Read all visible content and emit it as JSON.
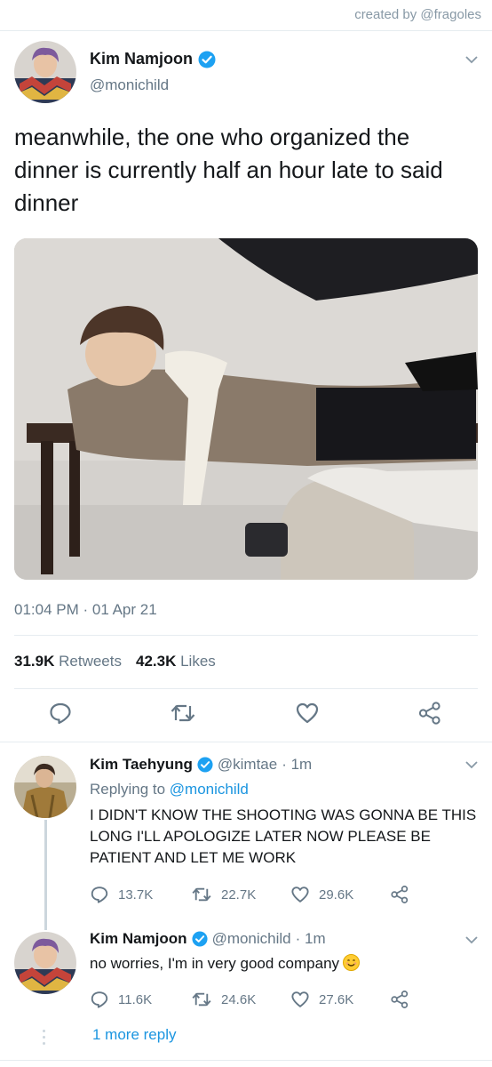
{
  "credit": "created by @fragoles",
  "main_tweet": {
    "name": "Kim Namjoon",
    "handle": "@monichild",
    "text": "meanwhile, the one who organized the dinner is currently half an hour late to said dinner",
    "timestamp": "01:04 PM · 01 Apr 21",
    "retweets_count": "31.9K",
    "retweets_label": "Retweets",
    "likes_count": "42.3K",
    "likes_label": "Likes"
  },
  "replies": [
    {
      "name": "Kim Taehyung",
      "handle": "@kimtae",
      "time": "· 1m",
      "replying_prefix": "Replying to",
      "replying_to": "@monichild",
      "text": "I DIDN'T KNOW THE SHOOTING WAS GONNA BE THIS LONG I'LL APOLOGIZE LATER NOW PLEASE BE PATIENT AND LET ME WORK",
      "reply_count": "13.7K",
      "retweet_count": "22.7K",
      "like_count": "29.6K"
    },
    {
      "name": "Kim Namjoon",
      "handle": "@monichild",
      "time": "· 1m",
      "text": "no worries, I'm in very good company",
      "reply_count": "11.6K",
      "retweet_count": "24.6K",
      "like_count": "27.6K"
    }
  ],
  "more_replies": "1 more reply",
  "icons": [
    "verified-badge-icon",
    "chevron-down-icon",
    "reply-icon",
    "retweet-icon",
    "like-icon",
    "share-icon",
    "smiling-emoji-icon"
  ],
  "colors": {
    "accent": "#1b95e0",
    "muted": "#657786",
    "divider": "#e6ecf0",
    "text": "#14171a"
  }
}
